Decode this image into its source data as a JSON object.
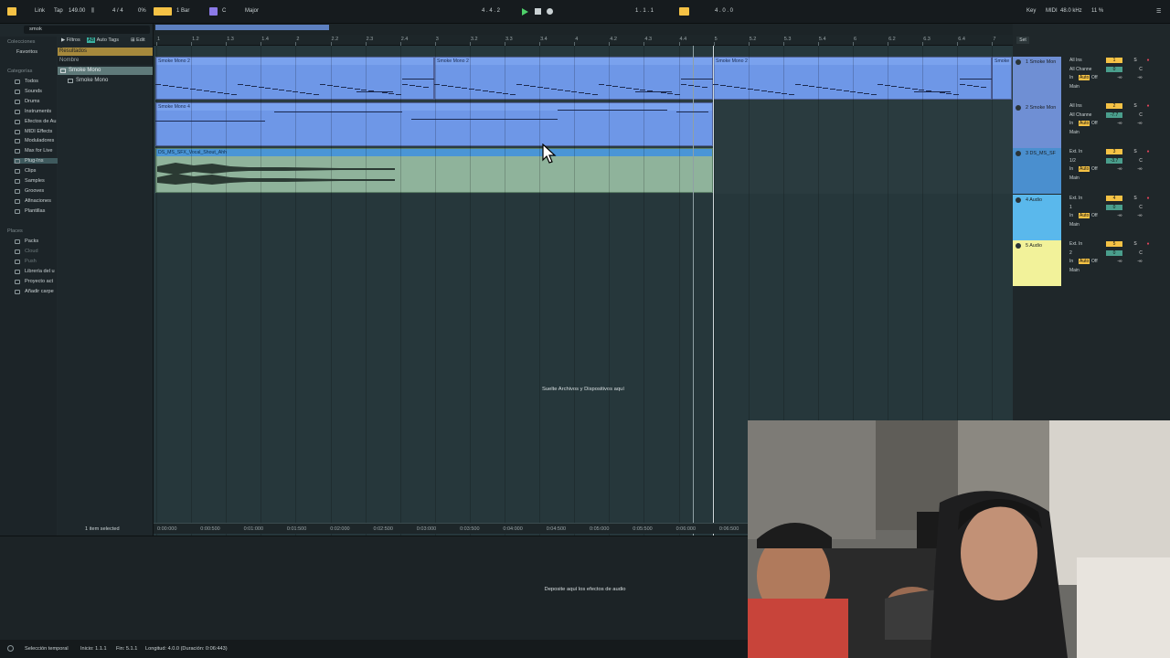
{
  "toolbar": {
    "link": "Link",
    "tap": "Tap",
    "tempo": "149.00",
    "signature": "4 / 4",
    "cpu": "0%",
    "quantize": "1 Bar",
    "key_root": "C",
    "scale": "Major",
    "position": "4 .  4 .  2",
    "loop_start": "1 .  1 .  1",
    "loop_length": "4 .  0 .  0",
    "key_label": "Key",
    "midi_label": "MIDI",
    "sample_rate": "48.0 kHz",
    "cpu_load": "11 %"
  },
  "browser": {
    "search_value": "smok",
    "collections_header": "Colecciones",
    "favorites": "Favoritos",
    "categories_header": "Categorías",
    "categories": [
      "Todos",
      "Sounds",
      "Drums",
      "Instruments",
      "Efectos de Au",
      "MIDI Effects",
      "Moduladores",
      "Max for Live",
      "Plug-Ins",
      "Clips",
      "Samples",
      "Grooves",
      "Afinaciones",
      "Plantillas"
    ],
    "places_header": "Places",
    "places": [
      "Packs",
      "Cloud",
      "Push",
      "Librería del u",
      "Proyecto act",
      "Añadir carpe"
    ],
    "filter_button": "Filtros",
    "auto_tags_button": "Auto Tags",
    "edit_button": "Edit",
    "results_label": "Resultados",
    "name_column": "Nombre",
    "results": [
      "Smoke Mono",
      "Smoke Mono"
    ],
    "selection_info": "1 item selected"
  },
  "ruler": {
    "labels": [
      "1",
      "1.2",
      "1.3",
      "1.4",
      "2",
      "2.2",
      "2.3",
      "2.4",
      "3",
      "3.2",
      "3.3",
      "3.4",
      "4",
      "4.2",
      "4.3",
      "4.4",
      "5",
      "5.2",
      "5.3",
      "5.4",
      "6",
      "6.2",
      "6.3",
      "6.4",
      "7"
    ],
    "set_button": "Set"
  },
  "clips": {
    "track1_a": "Smoke Mono 2",
    "track1_b": "Smoke Mono 2",
    "track1_c": "Smoke Mono 2",
    "track1_d": "Smoke M",
    "track2": "Smoke Mono 4",
    "track3": "DS_MS_SFX_Vocal_Shout_Ahh"
  },
  "drop_hint": "Suelte Archivos y Dispositivos aquí",
  "time_ruler": [
    "0:00:000",
    "0:00:500",
    "0:01:000",
    "0:01:500",
    "0:02:000",
    "0:02:500",
    "0:03:000",
    "0:03:500",
    "0:04:000",
    "0:04:500",
    "0:05:000",
    "0:05:500",
    "0:06:000",
    "0:06:500"
  ],
  "tracks": [
    {
      "name": "1 Smoke Mon",
      "color": "#6f8fd4",
      "input": "All Ins",
      "channel": "All Channe",
      "monitor": [
        "In",
        "Auto",
        "Off"
      ],
      "output": "Main",
      "number": "1",
      "solo": "S",
      "vol": "0",
      "pan": "C"
    },
    {
      "name": "2 Smoke Mon",
      "color": "#6f8fd4",
      "input": "All Ins",
      "channel": "All Channe",
      "monitor": [
        "In",
        "Auto",
        "Off"
      ],
      "output": "Main",
      "number": "2",
      "solo": "S",
      "vol": "-7.7",
      "pan": "C"
    },
    {
      "name": "3 DS_MS_SF",
      "color": "#4a8fcf",
      "input": "Ext. In",
      "channel": "1/2",
      "monitor": [
        "In",
        "Auto",
        "Off"
      ],
      "output": "Main",
      "number": "3",
      "solo": "S",
      "vol": "-3.7",
      "pan": "C"
    },
    {
      "name": "4 Audio",
      "color": "#5ab8ec",
      "input": "Ext. In",
      "channel": "1",
      "monitor": [
        "In",
        "Auto",
        "Off"
      ],
      "output": "Main",
      "number": "4",
      "solo": "S",
      "vol": "0",
      "pan": "C"
    },
    {
      "name": "5 Audio",
      "color": "#f2f29a",
      "input": "Ext. In",
      "channel": "2",
      "monitor": [
        "In",
        "Auto",
        "Off"
      ],
      "output": "Main",
      "number": "5",
      "solo": "S",
      "vol": "0",
      "pan": "C"
    }
  ],
  "inf_label": "-∞",
  "device_hint": "Deposite aquí los efectos de audio",
  "status": {
    "mode": "Selección temporal",
    "start": "Inicio: 1.1.1",
    "end": "Fin: 5.1.1",
    "length": "Longitud: 4.0.0  (Duración: 0:06:443)"
  },
  "colors": {
    "accent": "#f5c245",
    "midi_clip": "#6e97e7",
    "audio_clip": "#8fb39b",
    "play": "#4ed06a",
    "arm": "#e0445a"
  }
}
